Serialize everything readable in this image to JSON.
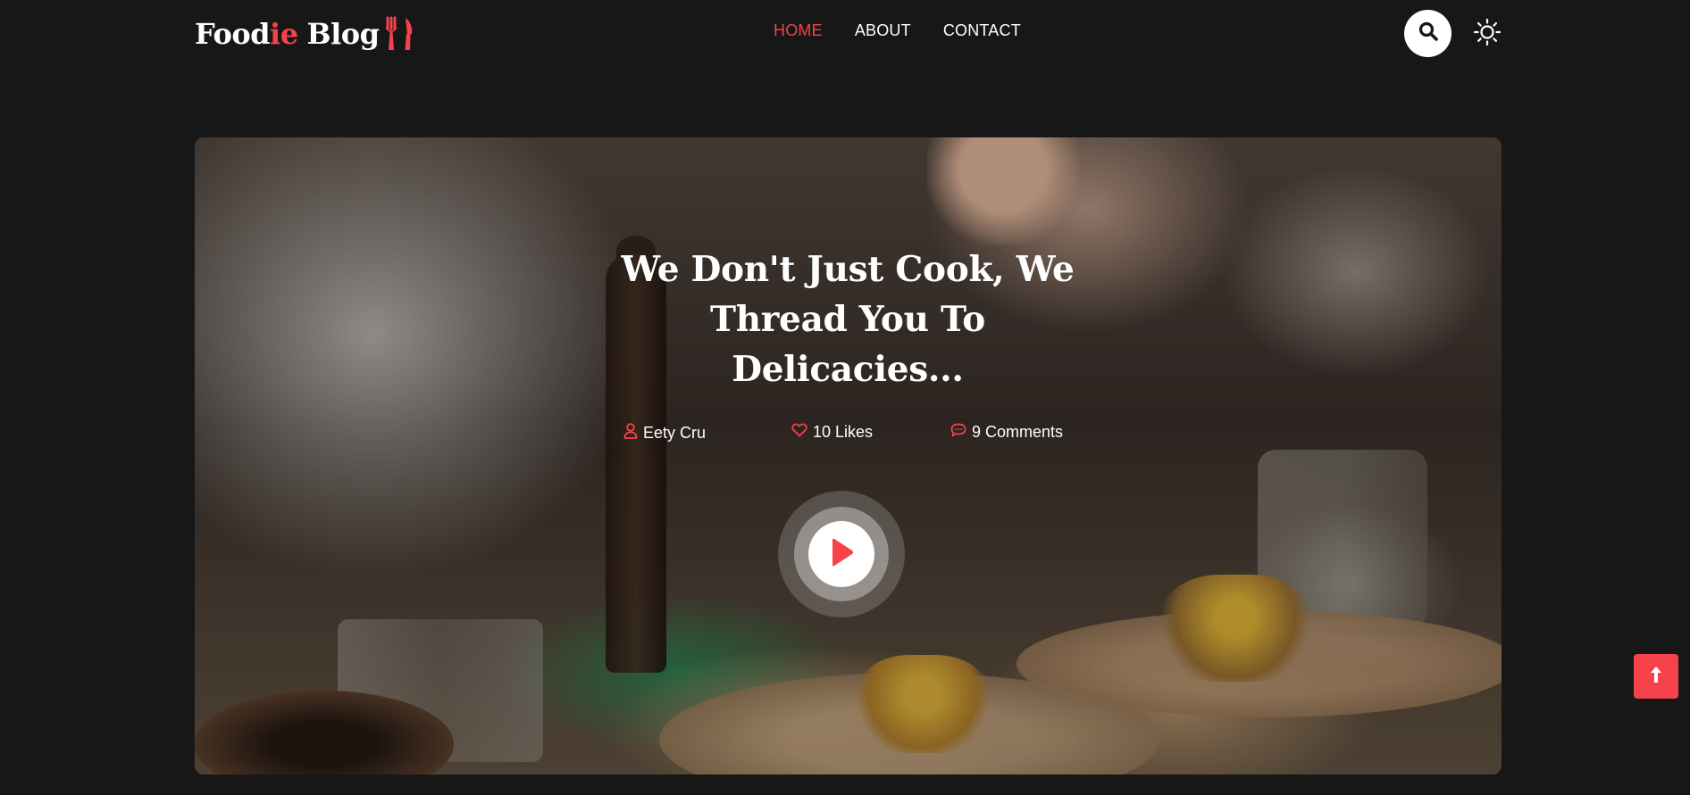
{
  "header": {
    "logo": {
      "part1": "Food",
      "accent": "ie",
      "part2": "Blog"
    },
    "nav": [
      {
        "label": "HOME",
        "active": true
      },
      {
        "label": "ABOUT",
        "active": false
      },
      {
        "label": "CONTACT",
        "active": false
      }
    ],
    "search_icon": "search-icon",
    "theme_icon": "sun-icon"
  },
  "hero": {
    "title": "We Don't Just Cook, We Thread You To Delicacies...",
    "meta": {
      "author": "Eety Cru",
      "likes": "10 Likes",
      "comments": "9 Comments"
    },
    "play_icon": "play-icon"
  },
  "back_to_top_icon": "arrow-up-icon",
  "colors": {
    "background": "#171717",
    "accent": "#f5424b",
    "text": "#ffffff"
  }
}
